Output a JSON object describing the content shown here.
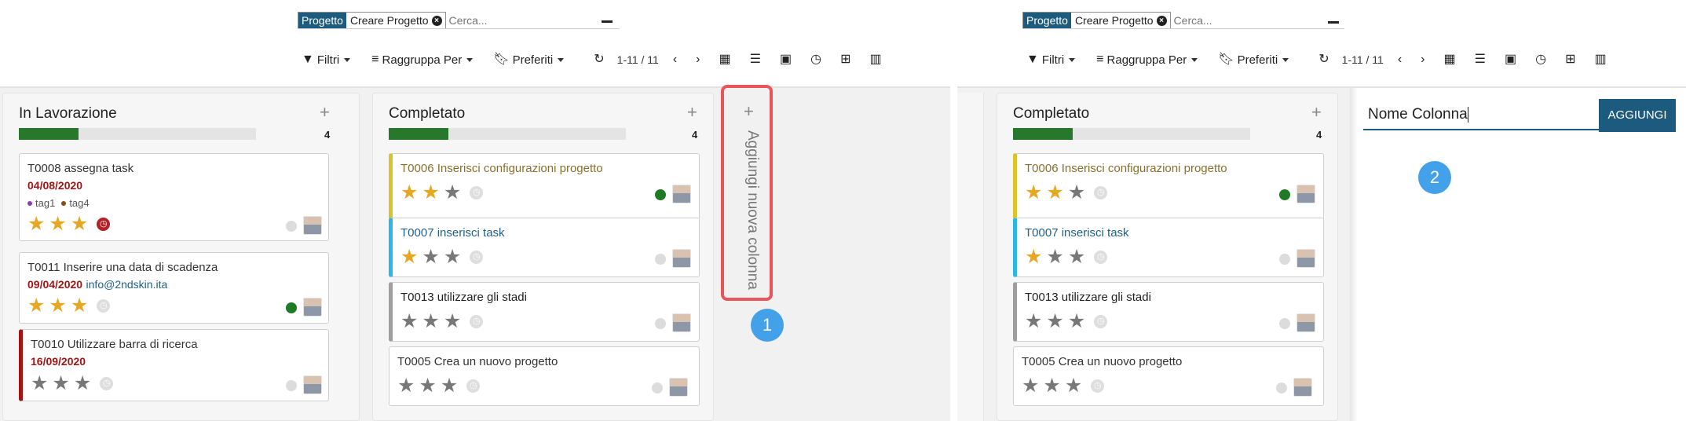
{
  "control": {
    "facet_category": "Progetto",
    "facet_value": "Creare Progetto",
    "facet_remove_icon": "x-circle-icon",
    "search_placeholder": "Cerca...",
    "filters": "Filtri",
    "group_by": "Raggruppa Per",
    "favorites": "Preferiti",
    "pager": "1-11 / 11"
  },
  "columns": {
    "in_progress": {
      "title": "In Lavorazione",
      "count": "4",
      "progress": 0.25,
      "cards": [
        {
          "title": "T0008 assegna task",
          "date": "04/08/2020",
          "tags": [
            "tag1",
            "tag4"
          ],
          "tag_colors": [
            "#8a3db5",
            "#8a4a12"
          ],
          "stars": 3,
          "deadline": "overdue"
        },
        {
          "title": "T0011 Inserire una data di scadenza",
          "date": "09/04/2020",
          "email": "info@2ndskin.ita",
          "stars": 3,
          "status": "green"
        },
        {
          "title": "T0010 Utilizzare barra di ricerca",
          "date": "16/09/2020",
          "stars": 0,
          "border_color": "#a31515"
        }
      ]
    },
    "completed": {
      "title": "Completato",
      "count": "4",
      "progress": 0.25,
      "cards": [
        {
          "title": "T0006 Inserisci configurazioni progetto",
          "stars": 2,
          "status": "green",
          "border_color": "#d8c32a"
        },
        {
          "title": "T0007 inserisci task",
          "stars": 1,
          "border_color": "#2bb7e5"
        },
        {
          "title": "T0013 utilizzare gli stadi",
          "stars": 0,
          "border_color": "#9e9e9e"
        },
        {
          "title": "T0005 Crea un nuovo progetto",
          "stars": 0
        }
      ]
    }
  },
  "add_column": {
    "label": "Aggiungi nuova colonna",
    "input_value": "Nome Colonna",
    "button": "AGGIUNGI"
  },
  "steps": [
    "1",
    "2"
  ],
  "colors": {
    "accent": "#1c5b7e",
    "progress": "#28782b",
    "highlight": "#e8555a",
    "step_badge": "#42a1e8",
    "star_on": "#e6a723"
  }
}
